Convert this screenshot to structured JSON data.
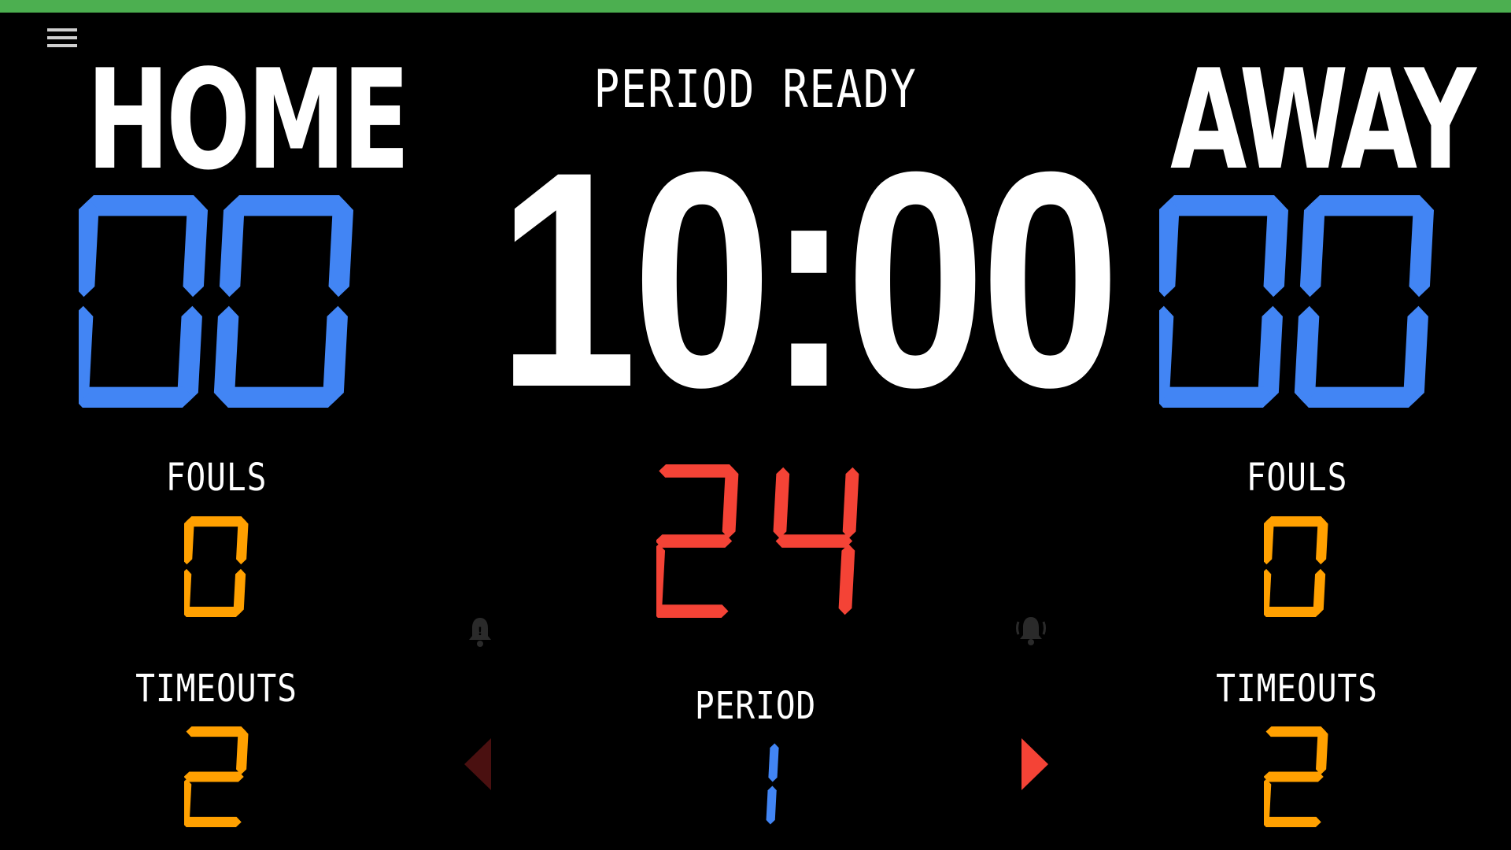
{
  "colors": {
    "top_bar": "#4caf50",
    "score": "#4285f4",
    "fouls": "#ffa000",
    "shot_clock": "#f44336",
    "text": "#ffffff",
    "period": "#4285f4",
    "arrow_active": "#f44336",
    "arrow_inactive": "#4a1010",
    "bell": "#2a2a2a"
  },
  "menu": {
    "icon": "hamburger-menu-icon"
  },
  "home": {
    "name": "HOME",
    "score": "00",
    "fouls_label": "FOULS",
    "fouls": "0",
    "timeouts_label": "TIMEOUTS",
    "timeouts": "2"
  },
  "away": {
    "name": "AWAY",
    "score": "00",
    "fouls_label": "FOULS",
    "fouls": "0",
    "timeouts_label": "TIMEOUTS",
    "timeouts": "2"
  },
  "game": {
    "status": "PERIOD READY",
    "clock": "10:00",
    "shot_clock": "24",
    "period_label": "PERIOD",
    "period": "1"
  },
  "icons": {
    "left_bell": "bell-icon",
    "right_bell": "bell-icon",
    "prev_period": "triangle-left-icon",
    "next_period": "triangle-right-icon"
  }
}
